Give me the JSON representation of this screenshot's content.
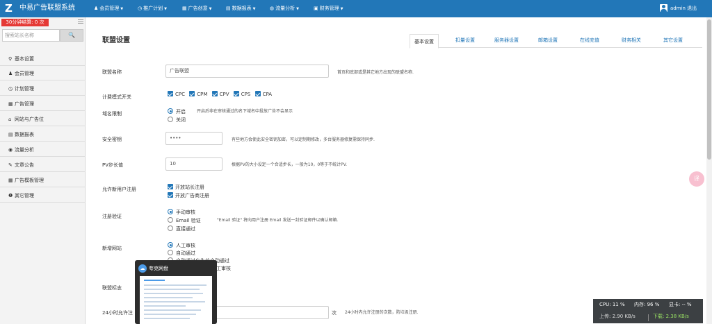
{
  "header": {
    "logo_glyph": "Z",
    "brand": "中易广告联盟系统",
    "nav": [
      {
        "icon": "user-icon",
        "glyph": "♟",
        "label": "会员管理"
      },
      {
        "icon": "clock-icon",
        "glyph": "◷",
        "label": "推广计划"
      },
      {
        "icon": "image-icon",
        "glyph": "▦",
        "label": "广告创意"
      },
      {
        "icon": "chart-icon",
        "glyph": "▤",
        "label": "数据报表"
      },
      {
        "icon": "filter-icon",
        "glyph": "◍",
        "label": "流量分析"
      },
      {
        "icon": "money-icon",
        "glyph": "▣",
        "label": "财务管理"
      }
    ],
    "admin": "admin",
    "logout": "退出",
    "color": "#2277b8"
  },
  "sidebar": {
    "timer": "30分钟结算: 0 次",
    "search_placeholder": "搜索站长名称",
    "search_icon": "🔍",
    "items": [
      {
        "icon": "map-marker-icon",
        "glyph": "⚲",
        "label": "基本设置"
      },
      {
        "icon": "user-icon",
        "glyph": "♟",
        "label": "会员管理"
      },
      {
        "icon": "clock-icon",
        "glyph": "◷",
        "label": "计划管理"
      },
      {
        "icon": "image-icon",
        "glyph": "▦",
        "label": "广告管理"
      },
      {
        "icon": "home-icon",
        "glyph": "⌂",
        "label": "网站与广告位"
      },
      {
        "icon": "table-icon",
        "glyph": "▤",
        "label": "数据报表"
      },
      {
        "icon": "eye-icon",
        "glyph": "◉",
        "label": "流量分析"
      },
      {
        "icon": "pencil-icon",
        "glyph": "✎",
        "label": "文章公告"
      },
      {
        "icon": "image-icon",
        "glyph": "▦",
        "label": "广告模板管理"
      },
      {
        "icon": "info-icon",
        "glyph": "❶",
        "label": "其它管理"
      }
    ]
  },
  "main": {
    "title": "联盟设置",
    "tabs": [
      "基本设置",
      "扣量设置",
      "服务器设置",
      "邮箱设置",
      "在线充值",
      "财务相关",
      "其它设置"
    ],
    "fields": {
      "name": {
        "label": "联盟名称",
        "value": "广告联盟",
        "hint": "首页和底部或是其它地方出现的联盟名称."
      },
      "billing": {
        "label": "计费模式开关",
        "options": [
          "CPC",
          "CPM",
          "CPV",
          "CPS",
          "CPA"
        ]
      },
      "domain": {
        "label": "域名限制",
        "opt_on": "开启",
        "opt_on_hint": "开启后非在审核通过的名下域名中投放广告不会显示",
        "opt_off": "关闭"
      },
      "key": {
        "label": "安全密钥",
        "value": "••••",
        "hint": "有些地方会使此安全密钥加密，可以定制期修改，多台服务器修复需保持同步."
      },
      "pv": {
        "label": "PV步长值",
        "value": "10",
        "hint": "根据PV的大小设定一个合适步长，一般为10，0等于不统计PV."
      },
      "register": {
        "label": "允许新用户注册",
        "opt1": "开放站长注册",
        "opt2": "开放广告商注册"
      },
      "verify": {
        "label": "注册验证",
        "opt1": "手动审核",
        "opt2": "Email 验证",
        "opt2_hint": "\"Email 验证\" 将向用户注册 Email 发送一封验证邮件以确认邮箱.",
        "opt3": "直接通过"
      },
      "site": {
        "label": "新增网站",
        "opt1": "人工审核",
        "opt2": "自动通过",
        "opt3": "自动通过广告位自动通过",
        "opt4": "工审核"
      },
      "logo": {
        "label": "联盟标志"
      },
      "daily": {
        "label": "24小时允许注",
        "unit": "次",
        "hint": "24小时内允许注册的次数，防垃圾注册."
      }
    }
  },
  "float_button": {
    "glyph": "译"
  },
  "taskbar_preview": {
    "title": "夸克网盘",
    "glyph": "☁"
  },
  "status": {
    "cpu_label": "CPU:",
    "cpu": "11 %",
    "mem_label": "内存:",
    "mem": "96 %",
    "gpu_label": "显卡:",
    "gpu": "-- %",
    "up_label": "上传:",
    "up": "2.90 KB/s",
    "down_label": "下载:",
    "down": "2.38 KB/s"
  }
}
